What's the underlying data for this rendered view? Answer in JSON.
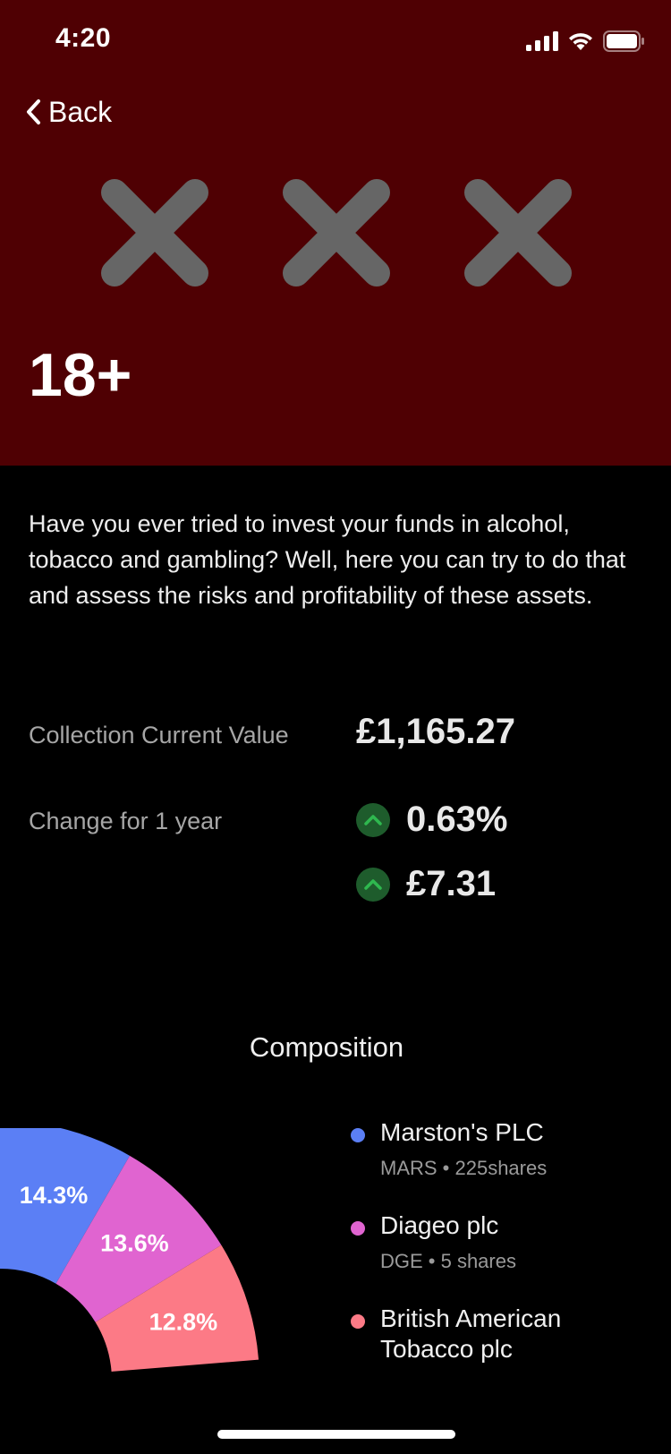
{
  "status_bar": {
    "time": "4:20"
  },
  "nav": {
    "back_label": "Back"
  },
  "header": {
    "background": "#4f0003",
    "rating_label": "18+",
    "icons": [
      "cross-icon",
      "cross-icon",
      "cross-icon"
    ]
  },
  "description": "Have you ever tried to invest your funds in alcohol, tobacco and gambling? Well, here you can try to do that and assess the risks and profitability of these assets.",
  "stats": {
    "current_value_label": "Collection Current Value",
    "current_value": "£1,165.27",
    "change_label": "Change for 1 year",
    "change_percent": "0.63%",
    "change_amount": "£7.31",
    "change_direction_icon": "chevron-up-icon",
    "positive_color": "#2fb84f"
  },
  "composition": {
    "title": "Composition",
    "holdings": [
      {
        "name": "Marston's PLC",
        "meta": "MARS • 225shares",
        "color": "#5b7ff5"
      },
      {
        "name": "Diageo plc",
        "meta": "DGE • 5 shares",
        "color": "#e064d0"
      },
      {
        "name": "British American Tobacco plc",
        "meta": "",
        "color": "#fc7a86"
      }
    ]
  },
  "chart_data": {
    "type": "pie",
    "categories": [
      "Marston's PLC",
      "Diageo plc",
      "British American Tobacco plc"
    ],
    "values": [
      14.3,
      13.6,
      12.8
    ],
    "labels": [
      "14.3%",
      "13.6%",
      "12.8%"
    ],
    "colors": [
      "#5b7ff5",
      "#e064d0",
      "#fc7a86"
    ]
  }
}
